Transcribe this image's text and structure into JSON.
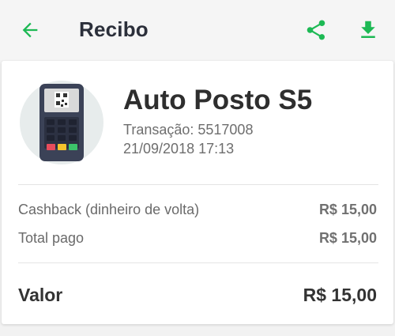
{
  "header": {
    "title": "Recibo",
    "back_icon": "arrow-left-icon",
    "share_icon": "share-icon",
    "download_icon": "download-icon",
    "accent_color": "#1db954"
  },
  "receipt": {
    "merchant": "Auto Posto S5",
    "transaction": "Transação: 5517008",
    "datetime": "21/09/2018 17:13",
    "merchant_icon": "card-terminal-icon",
    "lines": [
      {
        "label": "Cashback (dinheiro de volta)",
        "value": "R$ 15,00"
      },
      {
        "label": "Total pago",
        "value": "R$ 15,00"
      }
    ],
    "total": {
      "label": "Valor",
      "value": "R$ 15,00"
    }
  }
}
